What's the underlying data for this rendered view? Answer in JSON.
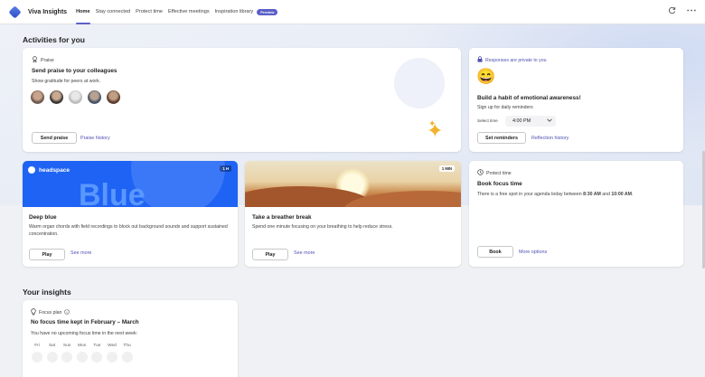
{
  "app": {
    "title": "Viva Insights"
  },
  "nav": {
    "tabs": [
      {
        "label": "Home"
      },
      {
        "label": "Stay connected"
      },
      {
        "label": "Protect time"
      },
      {
        "label": "Effective meetings"
      },
      {
        "label": "Inspiration library"
      }
    ],
    "preview_badge": "Preview"
  },
  "sections": {
    "activities": "Activities for you",
    "insights": "Your insights"
  },
  "praise_card": {
    "label": "Praise",
    "title": "Send praise to your colleagues",
    "text": "Show gratitude for peers at work.",
    "primary_button": "Send praise",
    "link": "Praise history"
  },
  "reflection_card": {
    "label": "Responses are private to you",
    "emoji": "😄",
    "title": "Build a habit of emotional awareness!",
    "text": "Sign up for daily reminders",
    "select_label": "Select time",
    "select_value": "4:00 PM",
    "primary_button": "Set reminders",
    "link": "Reflection history"
  },
  "headspace_card": {
    "brand": "headspace",
    "duration": "1 H",
    "banner_text": "Blue",
    "title": "Deep blue",
    "text": "Warm organ chords with field recordings to block out background sounds and support sustained concentration.",
    "primary_button": "Play",
    "link": "See more"
  },
  "breather_card": {
    "duration": "1 MIN",
    "title": "Take a breather break",
    "text": "Spend one minute focusing on your breathing to help reduce stress.",
    "primary_button": "Play",
    "link": "See more"
  },
  "protect_card": {
    "label": "Protect time",
    "title": "Book focus time",
    "text_prefix": "There is a free spot in your agenda today between ",
    "start": "8:30 AM",
    "text_mid": " and ",
    "end": "10:00 AM",
    "text_suffix": ".",
    "primary_button": "Book",
    "link": "More options"
  },
  "focus_card": {
    "label": "Focus plan",
    "title": "No focus time kept in February – March",
    "text": "You have no upcoming focus time in the next week:",
    "days": [
      "Fri",
      "Sat",
      "Sun",
      "Mon",
      "Tue",
      "Wed",
      "Thu"
    ]
  },
  "colors": {
    "accent": "#5b5fc7",
    "link": "#4f52b2",
    "headspace_blue": "#1f63f4",
    "sparkle": "#f2b22b"
  },
  "icons": {
    "praise": "award-icon",
    "lock": "lock-icon",
    "clock": "clock-icon",
    "bulb": "lightbulb-icon",
    "info": "info-icon",
    "refresh": "refresh-icon",
    "more": "more-icon",
    "chevron": "chevron-down-icon",
    "sparkle": "sparkle-icon"
  }
}
